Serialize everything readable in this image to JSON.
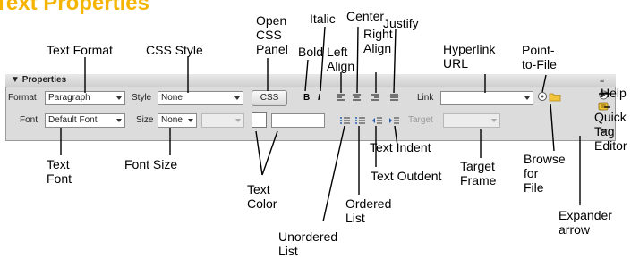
{
  "title": "Text Properties",
  "panel": {
    "header": "Properties",
    "row1": {
      "format_label": "Format",
      "format_value": "Paragraph",
      "style_label": "Style",
      "style_value": "None",
      "css_button": "CSS",
      "link_label": "Link"
    },
    "row2": {
      "font_label": "Font",
      "font_value": "Default Font",
      "size_label": "Size",
      "size_value": "None",
      "target_label": "Target"
    }
  },
  "callouts": {
    "text_format": "Text Format",
    "css_style": "CSS Style",
    "open_css_panel": "Open\nCSS\nPanel",
    "bold": "Bold",
    "italic": "Italic",
    "left_align": "Left\nAlign",
    "center": "Center",
    "right_align": "Right\nAlign",
    "justify": "Justify",
    "hyperlink_url": "Hyperlink\nURL",
    "point_to_file": "Point-\nto-File",
    "help": "Help",
    "quick_tag_editor": "Quick\nTag\nEditor",
    "text_font": "Text\nFont",
    "font_size": "Font Size",
    "text_color": "Text\nColor",
    "text_indent": "Text Indent",
    "text_outdent": "Text Outdent",
    "ordered_list": "Ordered\nList",
    "unordered_list": "Unordered\nList",
    "target_frame": "Target\nFrame",
    "browse_for_file": "Browse\nfor\nFile",
    "expander_arrow": "Expander\narrow"
  },
  "colors": {
    "title": "#f5b400",
    "panel": "#dcdcdc"
  }
}
